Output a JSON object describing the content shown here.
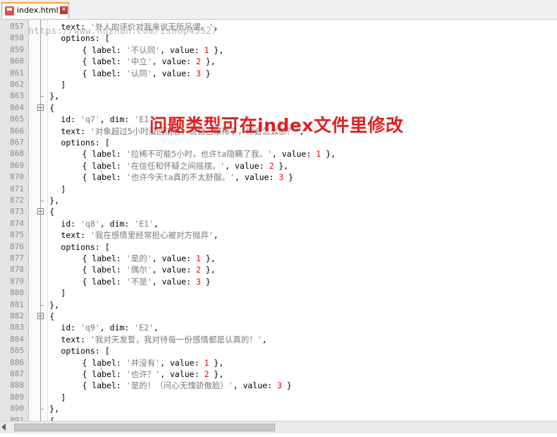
{
  "tab": {
    "label": "index.html",
    "close": "✕"
  },
  "watermark": "https://www.huzhan.com/ishop45527",
  "overlay_text": "问题类型可在index文件里修改",
  "lines": [
    {
      "n": "857",
      "parts": [
        [
          "k",
          "text: "
        ],
        [
          "s",
          "'外人的评价对我来说无所吊谓。'"
        ],
        [
          "k",
          ","
        ]
      ]
    },
    {
      "n": "858",
      "parts": [
        [
          "k",
          "options: ["
        ]
      ]
    },
    {
      "n": "859",
      "parts": [
        [
          "k",
          "  { label: "
        ],
        [
          "s",
          "'不认同'"
        ],
        [
          "k",
          ", value: "
        ],
        [
          "n",
          "1"
        ],
        [
          "k",
          " },"
        ]
      ]
    },
    {
      "n": "860",
      "parts": [
        [
          "k",
          "  { label: "
        ],
        [
          "s",
          "'中立'"
        ],
        [
          "k",
          ", value: "
        ],
        [
          "n",
          "2"
        ],
        [
          "k",
          " },"
        ]
      ]
    },
    {
      "n": "861",
      "parts": [
        [
          "k",
          "  { label: "
        ],
        [
          "s",
          "'认同'"
        ],
        [
          "k",
          ", value: "
        ],
        [
          "n",
          "3"
        ],
        [
          "k",
          " }"
        ]
      ]
    },
    {
      "n": "862",
      "parts": [
        [
          "k",
          "]"
        ]
      ]
    },
    {
      "n": "863",
      "parts": [
        [
          "k",
          "},"
        ]
      ]
    },
    {
      "n": "864",
      "parts": [
        [
          "k",
          "{"
        ]
      ]
    },
    {
      "n": "865",
      "parts": [
        [
          "k",
          "id: "
        ],
        [
          "s",
          "'q7'"
        ],
        [
          "k",
          ", dim: "
        ],
        [
          "s",
          "'E1'"
        ],
        [
          "k",
          ","
        ]
      ]
    },
    {
      "n": "866",
      "parts": [
        [
          "k",
          "text: "
        ],
        [
          "s",
          "'对象超过5小时没回消息，说自己窜稀了，你会怎么想？'"
        ],
        [
          "k",
          ","
        ]
      ]
    },
    {
      "n": "867",
      "parts": [
        [
          "k",
          "options: ["
        ]
      ]
    },
    {
      "n": "868",
      "parts": [
        [
          "k",
          "  { label: "
        ],
        [
          "s",
          "'拉稀不可能5小时，也许ta隐瞒了我。'"
        ],
        [
          "k",
          ", value: "
        ],
        [
          "n",
          "1"
        ],
        [
          "k",
          " },"
        ]
      ]
    },
    {
      "n": "869",
      "parts": [
        [
          "k",
          "  { label: "
        ],
        [
          "s",
          "'在信任和怀疑之间摇摆。'"
        ],
        [
          "k",
          ", value: "
        ],
        [
          "n",
          "2"
        ],
        [
          "k",
          " },"
        ]
      ]
    },
    {
      "n": "870",
      "parts": [
        [
          "k",
          "  { label: "
        ],
        [
          "s",
          "'也许今天ta真的不太舒服。'"
        ],
        [
          "k",
          ", value: "
        ],
        [
          "n",
          "3"
        ],
        [
          "k",
          " }"
        ]
      ]
    },
    {
      "n": "871",
      "parts": [
        [
          "k",
          "]"
        ]
      ]
    },
    {
      "n": "872",
      "parts": [
        [
          "k",
          "},"
        ]
      ]
    },
    {
      "n": "873",
      "parts": [
        [
          "k",
          "{"
        ]
      ]
    },
    {
      "n": "874",
      "parts": [
        [
          "k",
          "id: "
        ],
        [
          "s",
          "'q8'"
        ],
        [
          "k",
          ", dim: "
        ],
        [
          "s",
          "'E1'"
        ],
        [
          "k",
          ","
        ]
      ]
    },
    {
      "n": "875",
      "parts": [
        [
          "k",
          "text: "
        ],
        [
          "s",
          "'我在感情里经常担心被对方抛弃'"
        ],
        [
          "k",
          ","
        ]
      ]
    },
    {
      "n": "876",
      "parts": [
        [
          "k",
          "options: ["
        ]
      ]
    },
    {
      "n": "877",
      "parts": [
        [
          "k",
          "  { label: "
        ],
        [
          "s",
          "'是的'"
        ],
        [
          "k",
          ", value: "
        ],
        [
          "n",
          "1"
        ],
        [
          "k",
          " },"
        ]
      ]
    },
    {
      "n": "878",
      "parts": [
        [
          "k",
          "  { label: "
        ],
        [
          "s",
          "'偶尔'"
        ],
        [
          "k",
          ", value: "
        ],
        [
          "n",
          "2"
        ],
        [
          "k",
          " },"
        ]
      ]
    },
    {
      "n": "879",
      "parts": [
        [
          "k",
          "  { label: "
        ],
        [
          "s",
          "'不是'"
        ],
        [
          "k",
          ", value: "
        ],
        [
          "n",
          "3"
        ],
        [
          "k",
          " }"
        ]
      ]
    },
    {
      "n": "880",
      "parts": [
        [
          "k",
          "]"
        ]
      ]
    },
    {
      "n": "881",
      "parts": [
        [
          "k",
          "},"
        ]
      ]
    },
    {
      "n": "882",
      "parts": [
        [
          "k",
          "{"
        ]
      ]
    },
    {
      "n": "883",
      "parts": [
        [
          "k",
          "id: "
        ],
        [
          "s",
          "'q9'"
        ],
        [
          "k",
          ", dim: "
        ],
        [
          "s",
          "'E2'"
        ],
        [
          "k",
          ","
        ]
      ]
    },
    {
      "n": "884",
      "parts": [
        [
          "k",
          "text: "
        ],
        [
          "s",
          "'我对天发誓，我对待每一份感情都是认真的！'"
        ],
        [
          "k",
          ","
        ]
      ]
    },
    {
      "n": "885",
      "parts": [
        [
          "k",
          "options: ["
        ]
      ]
    },
    {
      "n": "886",
      "parts": [
        [
          "k",
          "  { label: "
        ],
        [
          "s",
          "'并没有'"
        ],
        [
          "k",
          ", value: "
        ],
        [
          "n",
          "1"
        ],
        [
          "k",
          " },"
        ]
      ]
    },
    {
      "n": "887",
      "parts": [
        [
          "k",
          "  { label: "
        ],
        [
          "s",
          "'也许？'"
        ],
        [
          "k",
          ", value: "
        ],
        [
          "n",
          "2"
        ],
        [
          "k",
          " },"
        ]
      ]
    },
    {
      "n": "888",
      "parts": [
        [
          "k",
          "  { label: "
        ],
        [
          "s",
          "'是的！（问心无愧骄傲脸）'"
        ],
        [
          "k",
          ", value: "
        ],
        [
          "n",
          "3"
        ],
        [
          "k",
          " }"
        ]
      ]
    },
    {
      "n": "889",
      "parts": [
        [
          "k",
          "]"
        ]
      ]
    },
    {
      "n": "890",
      "parts": [
        [
          "k",
          "},"
        ]
      ]
    },
    {
      "n": "891",
      "parts": [
        [
          "k",
          "{"
        ]
      ]
    }
  ]
}
